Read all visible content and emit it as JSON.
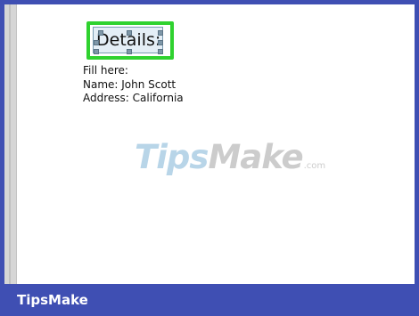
{
  "document": {
    "textbox_text": "Details:",
    "lines": [
      "Fill here:",
      "Name: John Scott",
      "Address: California"
    ]
  },
  "watermark": {
    "part1": "Tips",
    "part2": "Make",
    "suffix": ".com"
  },
  "footer": {
    "brand": "TipsMake"
  },
  "colors": {
    "frame": "#3f4fb3",
    "highlight": "#2fd22f",
    "textbox_fill": "#e4eef6"
  },
  "icons": {
    "handles": "resize-handle-icon"
  }
}
